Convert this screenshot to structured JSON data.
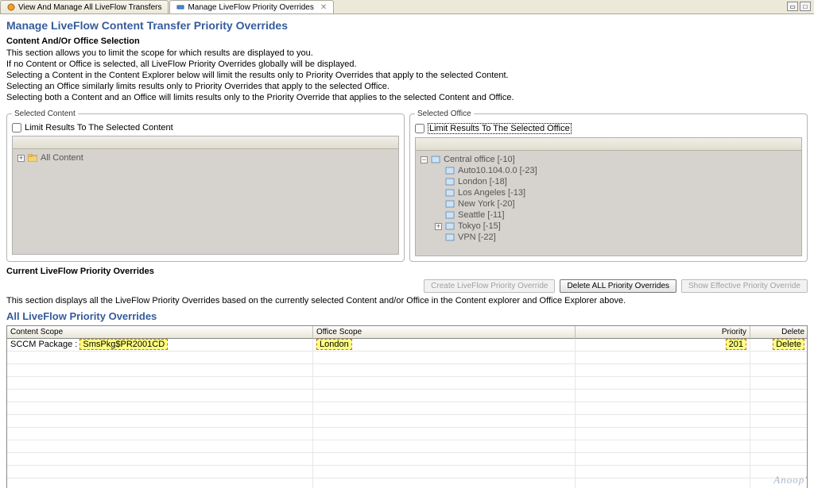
{
  "tabs": {
    "tab1_label": "View And Manage All LiveFlow Transfers",
    "tab2_label": "Manage LiveFlow Priority Overrides"
  },
  "title": "Manage LiveFlow Content Transfer Priority Overrides",
  "section1_header": "Content And/Or Office Selection",
  "intro": {
    "line1": "This section allows you to limit the scope for which results are displayed to you.",
    "line2": "If no Content or Office is selected, all LiveFlow Priority Overrides globally will be displayed.",
    "line3": "Selecting a Content in the Content Explorer below will limit the results only to Priority Overrides that apply to the selected Content.",
    "line4": "Selecting an Office similarly limits results only to Priority Overrides that apply to the selected Office.",
    "line5": "Selecting both a Content and an Office will limits results only to the Priority Override that applies to the selected Content and Office."
  },
  "groups": {
    "content_legend": "Selected Content",
    "content_limit_label": "Limit Results To The Selected Content",
    "office_legend": "Selected Office",
    "office_limit_label": "Limit Results To The Selected Office"
  },
  "content_tree": {
    "root": "All Content"
  },
  "office_tree": {
    "root": "Central office [-10]",
    "children": [
      "Auto10.104.0.0 [-23]",
      "London [-18]",
      "Los Angeles [-13]",
      "New York [-20]",
      "Seattle [-11]",
      "Tokyo [-15]",
      "VPN [-22]"
    ]
  },
  "mid_label": "Current LiveFlow Priority Overrides",
  "buttons": {
    "create": "Create LiveFlow Priority Override",
    "delete_all": "Delete ALL Priority Overrides",
    "show_effective": "Show Effective Priority Override"
  },
  "description_line": "This section displays all the LiveFlow  Priority Overrides based on the currently selected Content and/or Office in the Content explorer and Office Explorer above.",
  "sub_title": "All LiveFlow Priority Overrides",
  "grid": {
    "columns": {
      "c1": "Content Scope",
      "c2": "Office Scope",
      "c3": "Priority",
      "c4": "Delete"
    },
    "row": {
      "content_scope_prefix": "SCCM Package : ",
      "content_scope_value": "SmsPkg$PR2001CD",
      "office_scope": "London",
      "priority": "201",
      "delete_label": "Delete"
    }
  },
  "watermark": "Anoop'"
}
